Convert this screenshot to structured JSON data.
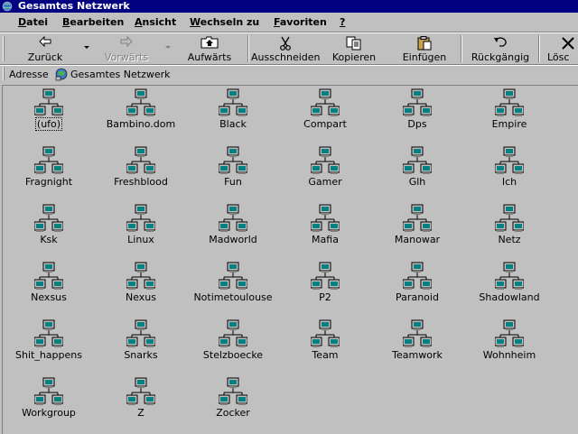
{
  "window": {
    "title": "Gesamtes Netzwerk"
  },
  "menu": [
    {
      "hotkey": "D",
      "rest": "atei"
    },
    {
      "hotkey": "B",
      "rest": "earbeiten"
    },
    {
      "hotkey": "A",
      "rest": "nsicht"
    },
    {
      "hotkey": "W",
      "rest": "echseln zu"
    },
    {
      "hotkey": "F",
      "rest": "avoriten"
    },
    {
      "hotkey": "?",
      "rest": ""
    }
  ],
  "toolbar": {
    "back": "Zurück",
    "forward": "Vorwärts",
    "up": "Aufwärts",
    "cut": "Ausschneiden",
    "copy": "Kopieren",
    "paste": "Einfügen",
    "undo": "Rückgängig",
    "delete": "Lösc"
  },
  "address": {
    "label": "Adresse",
    "value": "Gesamtes Netzwerk"
  },
  "items": [
    "(ufo)",
    "Bambino.dom",
    "Black",
    "Compart",
    "Dps",
    "Empire",
    "Fragnight",
    "Freshblood",
    "Fun",
    "Gamer",
    "Glh",
    "Ich",
    "Ksk",
    "Linux",
    "Madworld",
    "Mafia",
    "Manowar",
    "Netz",
    "Nexsus",
    "Nexus",
    "Notimetoulouse",
    "P2",
    "Paranoid",
    "Shadowland",
    "Shit_happens",
    "Snarks",
    "Stelzboecke",
    "Team",
    "Teamwork",
    "Wohnheim",
    "Workgroup",
    "Z",
    "Zocker"
  ],
  "colors": {
    "titlebar": "#000080",
    "background": "#c0c0c0",
    "monitor_screen": "#008080"
  },
  "icons": {
    "item": "network-workgroup-icon",
    "address": "entire-network-icon"
  }
}
